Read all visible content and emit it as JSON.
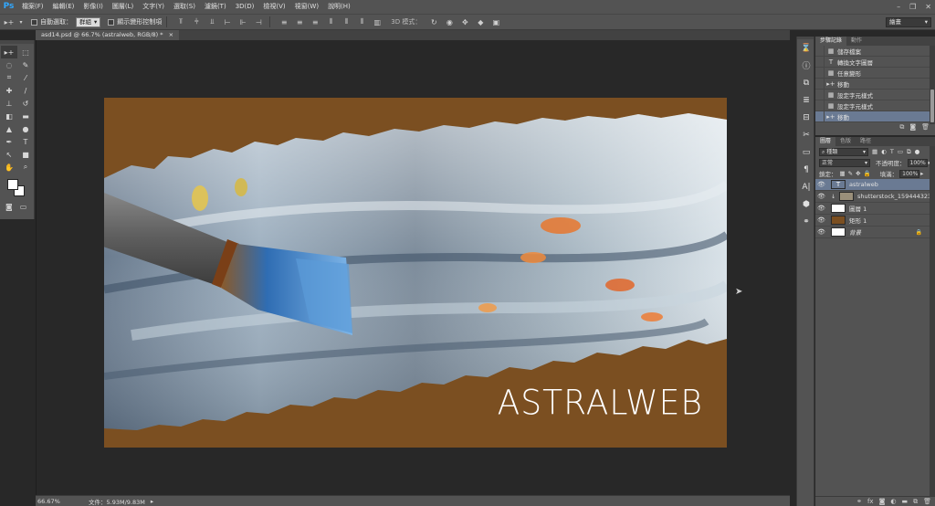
{
  "app": {
    "logo": "Ps",
    "menus": [
      "檔案(F)",
      "編輯(E)",
      "影像(I)",
      "圖層(L)",
      "文字(Y)",
      "選取(S)",
      "濾鏡(T)",
      "3D(D)",
      "檢視(V)",
      "視窗(W)",
      "說明(H)"
    ],
    "window_controls": [
      "–",
      "❐",
      "✕"
    ]
  },
  "options": {
    "auto_select_label": "自動選取：",
    "auto_select_value": "群組",
    "transform_label": "顯示變形控制項",
    "mode_3d_label": "3D 模式：",
    "workspace": "繪畫"
  },
  "document": {
    "tab_label": "asd14.psd @ 66.7% (astralweb, RGB/8) *",
    "tab_close": "×",
    "artwork_text": "ASTRALWEB",
    "zoom": "66.67%",
    "doc_info": "文件：5.93M/9.83M",
    "colors": {
      "background": "#7b4f21",
      "brush_handle": "#6b6b6b",
      "ferrule": "#8a4a1e",
      "bristles": "#3d7fc4"
    }
  },
  "tools": [
    {
      "icon": "move-icon",
      "glyph": "▸+"
    },
    {
      "icon": "marquee-icon",
      "glyph": "⬚"
    },
    {
      "icon": "lasso-icon",
      "glyph": "◌"
    },
    {
      "icon": "quick-select-icon",
      "glyph": "✎"
    },
    {
      "icon": "crop-icon",
      "glyph": "⌗"
    },
    {
      "icon": "eyedropper-icon",
      "glyph": "⁄"
    },
    {
      "icon": "healing-icon",
      "glyph": "✚"
    },
    {
      "icon": "brush-icon",
      "glyph": "/"
    },
    {
      "icon": "stamp-icon",
      "glyph": "⊥"
    },
    {
      "icon": "history-brush-icon",
      "glyph": "↺"
    },
    {
      "icon": "eraser-icon",
      "glyph": "◧"
    },
    {
      "icon": "gradient-icon",
      "glyph": "▬"
    },
    {
      "icon": "blur-icon",
      "glyph": "▲"
    },
    {
      "icon": "dodge-icon",
      "glyph": "●"
    },
    {
      "icon": "pen-icon",
      "glyph": "✒"
    },
    {
      "icon": "type-icon",
      "glyph": "T"
    },
    {
      "icon": "path-select-icon",
      "glyph": "↖"
    },
    {
      "icon": "shape-icon",
      "glyph": "■"
    },
    {
      "icon": "hand-icon",
      "glyph": "✋"
    },
    {
      "icon": "zoom-icon",
      "glyph": "⌕"
    }
  ],
  "dock": [
    "history-icon",
    "info-icon",
    "layer-comps-icon",
    "brush-presets-icon",
    "character-icon",
    "tools-preset-icon",
    "adjust-icon",
    "paragraph-icon",
    "styles-icon",
    "channels-icon",
    "paths-icon"
  ],
  "history": {
    "tabs": [
      "步驟記錄",
      "動作"
    ],
    "items": [
      {
        "label": "儲存檔案",
        "icon": "▦"
      },
      {
        "label": "轉換文字圖層",
        "icon": "T"
      },
      {
        "label": "任意變形",
        "icon": "▦"
      },
      {
        "label": "移動",
        "icon": "▸+"
      },
      {
        "label": "設定字元樣式",
        "icon": "▦"
      },
      {
        "label": "設定字元樣式",
        "icon": "▦"
      },
      {
        "label": "移動",
        "icon": "▸+"
      }
    ],
    "selected_index": 6
  },
  "layers": {
    "tabs": [
      "圖層",
      "色版",
      "路徑"
    ],
    "filter": "種類",
    "blend_mode": "正常",
    "opacity_label": "不透明度：",
    "opacity_value": "100%",
    "lock_label": "鎖定：",
    "fill_label": "填滿：",
    "fill_value": "100%",
    "items": [
      {
        "name": "astralweb",
        "thumb": "T",
        "thumb_color": "#6a7a93"
      },
      {
        "name": "shutterstock_159444323",
        "thumb": "",
        "thumb_color": "#9a8f7a"
      },
      {
        "name": "圖層 1",
        "thumb": "",
        "thumb_color": "#ffffff"
      },
      {
        "name": "矩形 1",
        "thumb": "",
        "thumb_color": "#7b4f21"
      },
      {
        "name": "背景",
        "thumb": "",
        "thumb_color": "#ffffff"
      }
    ],
    "selected_index": 0
  }
}
